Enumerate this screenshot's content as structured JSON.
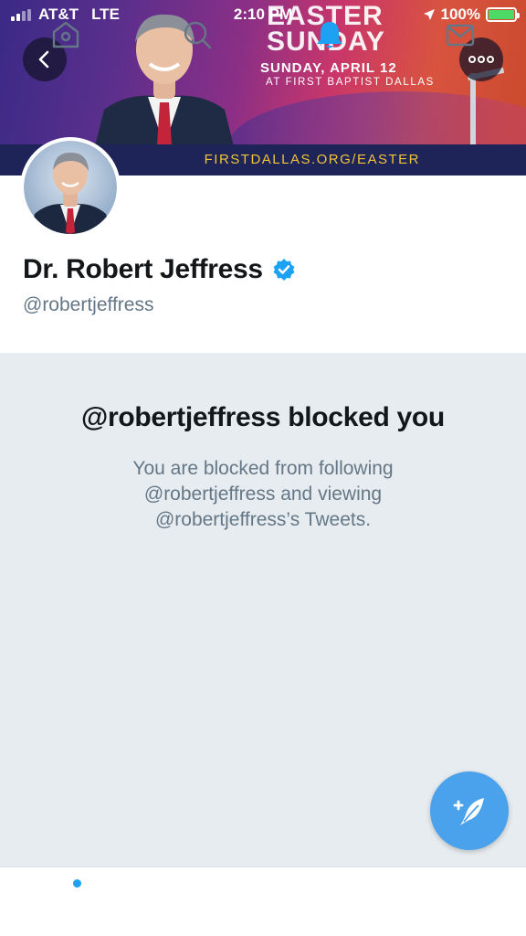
{
  "status_bar": {
    "carrier": "AT&T",
    "network": "LTE",
    "time": "2:10 PM",
    "battery": "100%",
    "colors": {
      "battery_fill": "#4cd964"
    }
  },
  "banner": {
    "headline_line1": "EASTER",
    "headline_line2": "SUNDAY",
    "date": "SUNDAY, APRIL 12",
    "venue": "AT FIRST BAPTIST DALLAS",
    "url": "FIRSTDALLAS.ORG/EASTER"
  },
  "header_buttons": {
    "back_icon": "chevron-left-icon",
    "more_icon": "more-dots-icon"
  },
  "profile": {
    "name": "Dr. Robert Jeffress",
    "verified_icon": "verified-badge-icon",
    "handle": "@robertjeffress"
  },
  "blocked_notice": {
    "title": "@robertjeffress blocked you",
    "body": "You are blocked from following @robertjeffress and viewing @robertjeffress’s Tweets."
  },
  "compose_fab": {
    "icon": "compose-tweet-icon"
  },
  "tab_bar": {
    "items": [
      {
        "name": "home",
        "icon": "home-icon",
        "badge": true
      },
      {
        "name": "search",
        "icon": "search-icon",
        "badge": false
      },
      {
        "name": "notifications",
        "icon": "bell-icon",
        "badge": false,
        "active": true
      },
      {
        "name": "messages",
        "icon": "mail-icon",
        "badge": false
      }
    ]
  },
  "colors": {
    "accent": "#1da1f2",
    "fab": "#4aa1ec",
    "panel_bg": "#e6ecf0",
    "secondary_text": "#657786",
    "primary_text": "#14171a"
  }
}
